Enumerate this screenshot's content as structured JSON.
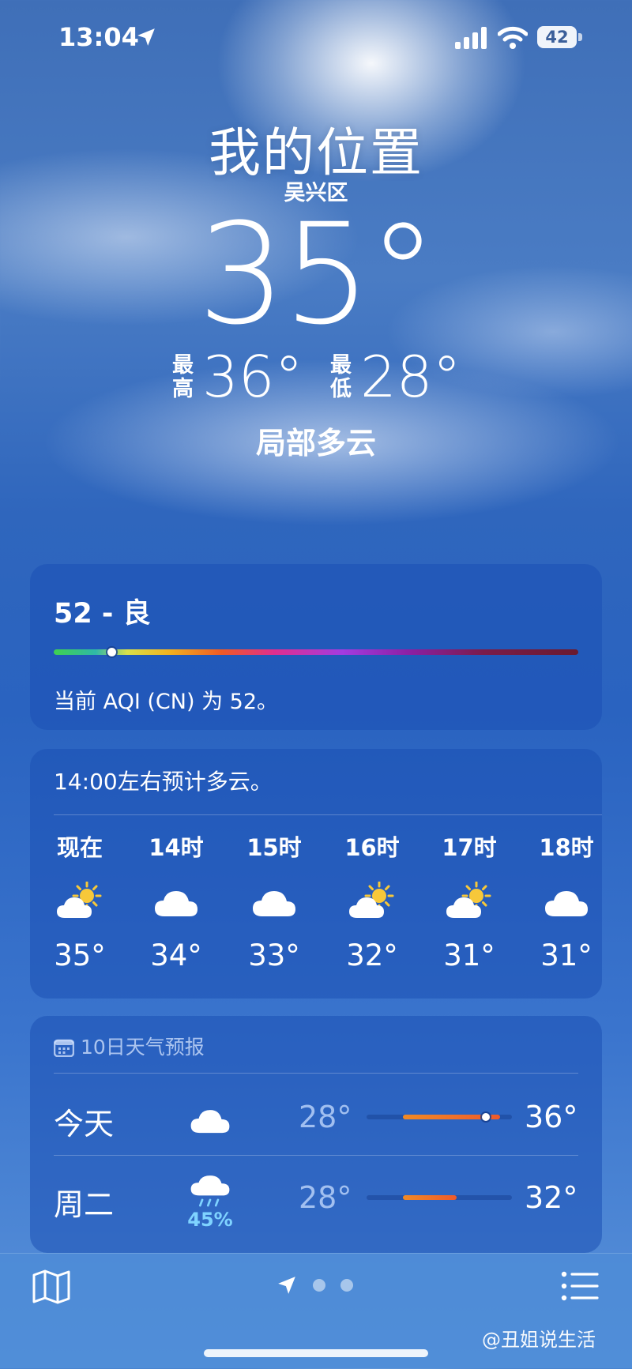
{
  "status": {
    "time": "13:04",
    "battery": "42",
    "icons": [
      "location-arrow-icon",
      "signal-icon",
      "wifi-icon",
      "battery-icon"
    ]
  },
  "hero": {
    "location": "我的位置",
    "district": "吴兴区",
    "temperature": "35°",
    "high_label": "最高",
    "high": "36°",
    "low_label": "最低",
    "low": "28°",
    "condition": "局部多云"
  },
  "aqi": {
    "value": "52 - 良",
    "indicator_fraction": 0.11,
    "description": "当前 AQI (CN) 为 52。"
  },
  "hourly": {
    "summary": "14:00左右预计多云。",
    "items": [
      {
        "label": "现在",
        "icon": "partly-sunny-icon",
        "temp": "35°"
      },
      {
        "label": "14时",
        "icon": "cloud-icon",
        "temp": "34°"
      },
      {
        "label": "15时",
        "icon": "cloud-icon",
        "temp": "33°"
      },
      {
        "label": "16时",
        "icon": "partly-sunny-icon",
        "temp": "32°"
      },
      {
        "label": "17时",
        "icon": "partly-sunny-icon",
        "temp": "31°"
      },
      {
        "label": "18时",
        "icon": "cloud-icon",
        "temp": "31°"
      }
    ]
  },
  "daily": {
    "header": "10日天气预报",
    "days": [
      {
        "name": "今天",
        "icon": "cloud-icon",
        "precip": "",
        "low": "28°",
        "high": "36°",
        "range_start": 0.25,
        "range_end": 0.92,
        "current_fraction": 0.82
      },
      {
        "name": "周二",
        "icon": "rain-cloud-icon",
        "precip": "45%",
        "low": "28°",
        "high": "32°",
        "range_start": 0.25,
        "range_end": 0.62
      }
    ]
  },
  "bottom": {
    "watermark": "@丑姐说生活",
    "page_count": 3,
    "active_page": 0
  },
  "colors": {
    "temp_range": "#ef5a2a",
    "precip": "#7fd3ff"
  }
}
